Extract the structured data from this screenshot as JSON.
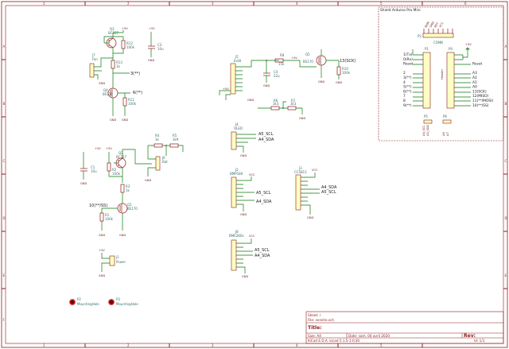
{
  "sheet": {
    "columns": [
      "1",
      "2",
      "3",
      "4",
      "5",
      "6"
    ],
    "rows": [
      "A",
      "B",
      "C",
      "D",
      "E",
      "F"
    ]
  },
  "shield": {
    "title": "Shield Arduino Pro Mini",
    "p1": {
      "ref": "P1",
      "pins": [
        "1(Tx)",
        "0(Rx)",
        "Reset",
        "",
        "2",
        "3(**)",
        "4",
        "5(**)",
        "6(**)",
        "7",
        "8",
        "9(**)"
      ]
    },
    "p4": {
      "ref": "P4",
      "pins": [
        "",
        "",
        "Reset",
        "",
        "A3",
        "A2",
        "A1",
        "A0",
        "13(SCK)",
        "12(MISO)",
        "11(**/MOSI)",
        "10(**/SS)"
      ]
    },
    "p2": {
      "ref": "P2",
      "value": "CONN"
    },
    "p5": {
      "ref": "P5",
      "labels": [
        "A4_SCL",
        "A5_SDA"
      ]
    },
    "p6": {
      "ref": "P6",
      "labels": [
        "A6",
        "A7"
      ]
    },
    "vcc": "+5V",
    "gnd": "GND"
  },
  "top_left": {
    "q3": {
      "ref": "Q3",
      "value": "BC327"
    },
    "r12": {
      "ref": "R12",
      "value": "100k"
    },
    "r13": {
      "ref": "R13",
      "value": "1k"
    },
    "c3": {
      "ref": "C3",
      "value": "10u"
    },
    "j7": {
      "ref": "J7",
      "value": "Fan"
    },
    "q4": {
      "ref": "Q4",
      "value": "BS170"
    },
    "r11": {
      "ref": "R11",
      "value": "100k"
    },
    "net_3": "3(**)",
    "net_6": "6(**)",
    "pwr": "+5V",
    "gnd": "GND"
  },
  "top_mid": {
    "j5": {
      "ref": "J5",
      "value": "Ext8"
    },
    "r8": {
      "ref": "R8",
      "value": "15k"
    },
    "c4": {
      "ref": "C4",
      "value": "22u"
    },
    "q5": {
      "ref": "Q5",
      "value": "BS170"
    },
    "r10": {
      "ref": "R10",
      "value": "100k"
    },
    "r6": {
      "ref": "R6",
      "value": "3k3"
    },
    "r7": {
      "ref": "R7",
      "value": "3k3"
    },
    "net_sck": "13(SCK)",
    "pwr": "+5V",
    "gnd": "GND"
  },
  "mid_left": {
    "q2": {
      "ref": "Q2",
      "value": "BC327"
    },
    "r2": {
      "ref": "R2",
      "value": "100k"
    },
    "r3": {
      "ref": "R3",
      "value": "1k"
    },
    "c1": {
      "ref": "C1",
      "value": "10u"
    },
    "q1": {
      "ref": "Q1",
      "value": "BS170"
    },
    "r4": {
      "ref": "R4",
      "value": "1k"
    },
    "r5": {
      "ref": "R5",
      "value": "3k9"
    },
    "j6": {
      "ref": "J6",
      "value": "Bat"
    },
    "r1": {
      "ref": "R1",
      "value": "100k"
    },
    "net_10": "10(**/SS)",
    "pwr": "+5V",
    "gnd": "GND"
  },
  "i2c": {
    "j4": {
      "ref": "J4",
      "value": "OLED",
      "scl": "A5_SCL",
      "sda": "A4_SDA"
    },
    "j2": {
      "ref": "J2",
      "value": "BMP180",
      "vcc": "VCC",
      "scl": "A5_SCL",
      "sda": "A4_SDA"
    },
    "j3": {
      "ref": "J3",
      "value": "CCS811",
      "vcc": "VCC",
      "sda": "A4_SDA",
      "scl": "A5_SCL"
    },
    "j8": {
      "ref": "J8",
      "value": "BME280x",
      "vcc": "VCC",
      "scl": "A5_SCL",
      "sda": "A4_SDA"
    },
    "gnd": "GND"
  },
  "power": {
    "j1": {
      "ref": "J1",
      "value": "Power"
    },
    "pwr": "+5V",
    "gnd": "GND"
  },
  "holes": [
    {
      "ref": "P2",
      "value": "MountingHole"
    },
    {
      "ref": "P3",
      "value": "MountingHole"
    }
  ],
  "title_block": {
    "sheet": "Sheet: /",
    "file": "File: senshe.sch",
    "title_label": "Title:",
    "size": "Size: A4",
    "date": "Date: sam. 04 avril 2020",
    "rev_label": "Rev:",
    "kicad": "KiCad E.D.A.  kicad 5.1.5-1.fc30",
    "id": "Id: 1/1"
  }
}
